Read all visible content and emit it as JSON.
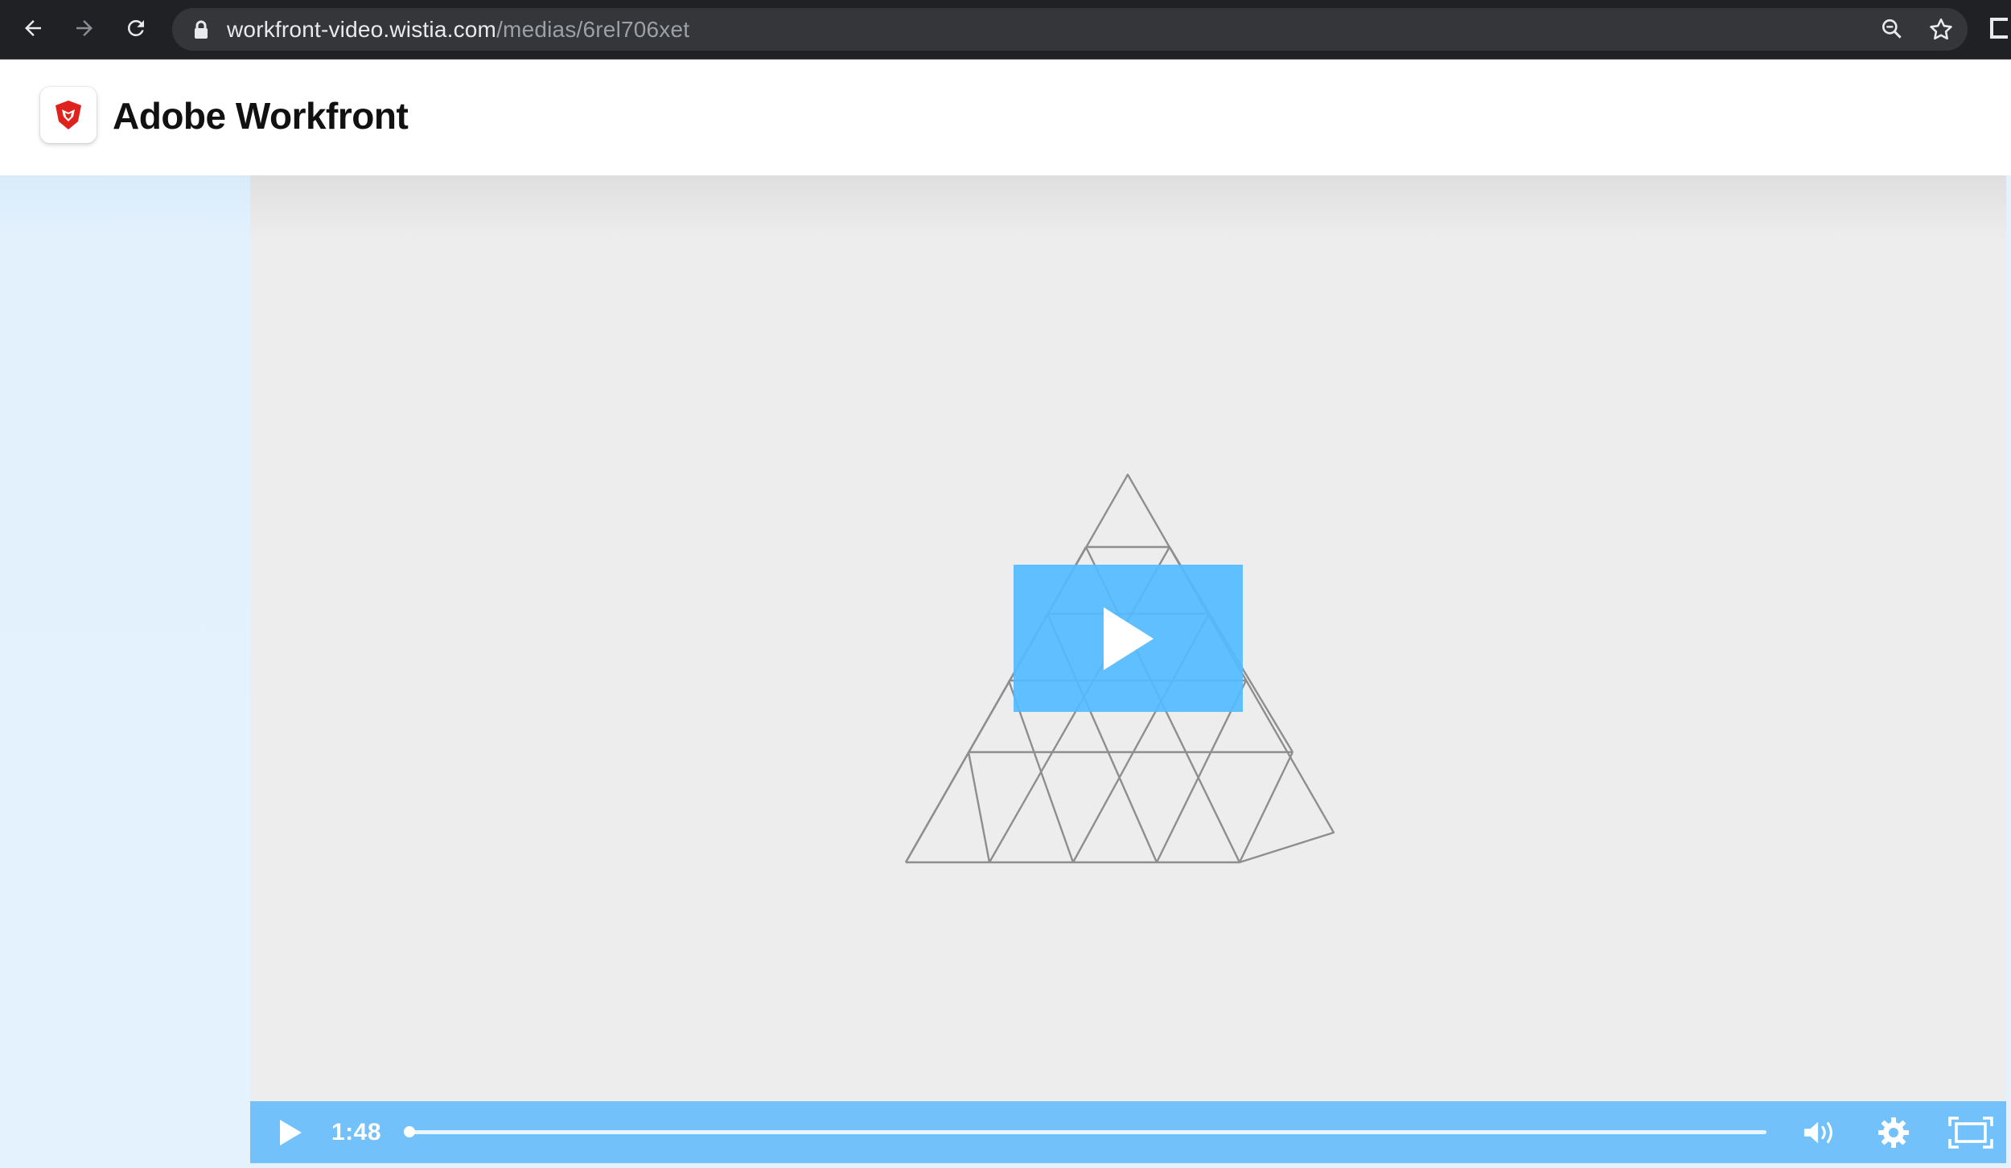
{
  "browser": {
    "url_host": "workfront-video.wistia.com",
    "url_path": "/medias/6rel706xet",
    "icons": [
      "back-arrow-icon",
      "forward-arrow-icon",
      "reload-icon",
      "lock-icon",
      "zoom-icon",
      "star-icon",
      "extension-icon"
    ]
  },
  "header": {
    "brand": "Adobe Workfront",
    "logo_icon": "workfront-logo-icon",
    "logo_color": "#e0221c"
  },
  "player": {
    "background": "#ededed",
    "accent": "#54bbff",
    "control_bar_color": "#72c1fb",
    "side_color": "#e4f2fd",
    "big_play_icon": "play-icon",
    "controls": {
      "play_icon": "play-icon",
      "time": "1:48",
      "progress_fraction": 0.0,
      "volume_icon": "volume-icon",
      "settings_icon": "gear-icon",
      "fullscreen_icon": "fullscreen-icon"
    }
  }
}
